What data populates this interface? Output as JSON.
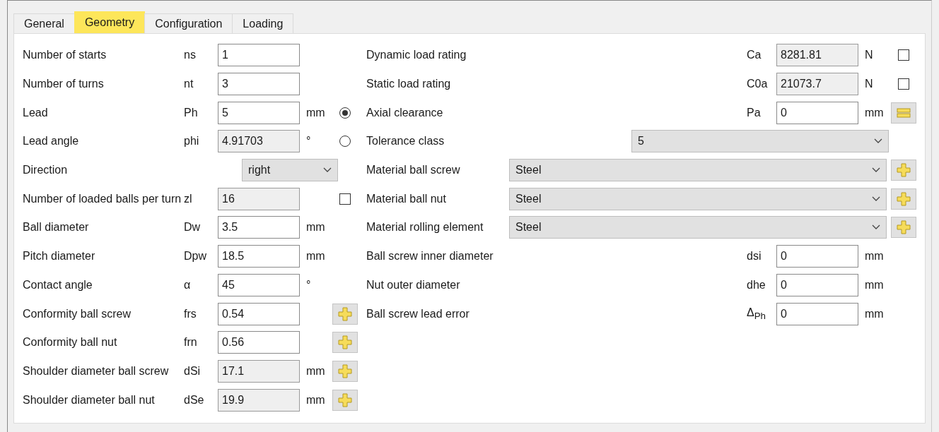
{
  "tabs": [
    {
      "label": "General",
      "selected": false
    },
    {
      "label": "Geometry",
      "selected": true
    },
    {
      "label": "Configuration",
      "selected": false
    },
    {
      "label": "Loading",
      "selected": false
    }
  ],
  "left_rows": [
    {
      "label": "Number of starts",
      "symbol": "ns",
      "value": "1",
      "readonly": false
    },
    {
      "label": "Number of turns",
      "symbol": "nt",
      "value": "3",
      "readonly": false
    },
    {
      "label": "Lead",
      "symbol": "Ph",
      "value": "5",
      "readonly": false,
      "unit": "mm",
      "extra": {
        "kind": "radio",
        "selected": true
      }
    },
    {
      "label": "Lead angle",
      "symbol": "phi",
      "value": "4.91703",
      "readonly": true,
      "unit": "°",
      "extra": {
        "kind": "radio",
        "selected": false
      }
    },
    {
      "label": "Direction",
      "kind": "select",
      "value": "right"
    },
    {
      "label": "Number of loaded balls per turn",
      "symbol": "zl",
      "value": "16",
      "readonly": true,
      "extra": {
        "kind": "checkbox",
        "checked": false
      }
    },
    {
      "label": "Ball diameter",
      "symbol": "Dw",
      "value": "3.5",
      "readonly": false,
      "unit": "mm"
    },
    {
      "label": "Pitch diameter",
      "symbol": "Dpw",
      "value": "18.5",
      "readonly": false,
      "unit": "mm"
    },
    {
      "label": "Contact angle",
      "symbol": "α",
      "value": "45",
      "readonly": false,
      "unit": "°"
    },
    {
      "label": "Conformity ball screw",
      "symbol": "frs",
      "value": "0.54",
      "readonly": false,
      "extra": {
        "kind": "plus"
      }
    },
    {
      "label": "Conformity ball nut",
      "symbol": "frn",
      "value": "0.56",
      "readonly": false,
      "extra": {
        "kind": "plus"
      }
    },
    {
      "label": "Shoulder diameter ball screw",
      "symbol": "dSi",
      "value": "17.1",
      "readonly": true,
      "unit": "mm",
      "extra": {
        "kind": "plus"
      }
    },
    {
      "label": "Shoulder diameter ball nut",
      "symbol": "dSe",
      "value": "19.9",
      "readonly": true,
      "unit": "mm",
      "extra": {
        "kind": "plus"
      }
    }
  ],
  "right_rows": [
    {
      "kind": "field",
      "label": "Dynamic load rating",
      "symbol": "Ca",
      "value": "8281.81",
      "readonly": true,
      "unit": "N",
      "extra": {
        "kind": "checkbox",
        "checked": false
      }
    },
    {
      "kind": "field",
      "label": "Static load rating",
      "symbol": "C0a",
      "value": "21073.7",
      "readonly": true,
      "unit": "N",
      "extra": {
        "kind": "checkbox",
        "checked": false
      }
    },
    {
      "kind": "field",
      "label": "Axial clearance",
      "symbol": "Pa",
      "value": "0",
      "readonly": false,
      "unit": "mm",
      "extra": {
        "kind": "equals"
      }
    },
    {
      "kind": "short-select",
      "label": "Tolerance class",
      "value": "5"
    },
    {
      "kind": "select",
      "label": "Material ball screw",
      "value": "Steel",
      "extra": {
        "kind": "plus"
      }
    },
    {
      "kind": "select",
      "label": "Material ball nut",
      "value": "Steel",
      "extra": {
        "kind": "plus"
      }
    },
    {
      "kind": "select",
      "label": "Material rolling element",
      "value": "Steel",
      "extra": {
        "kind": "plus"
      }
    },
    {
      "kind": "field",
      "label": "Ball screw inner diameter",
      "symbol": "dsi",
      "value": "0",
      "readonly": false,
      "unit": "mm"
    },
    {
      "kind": "field",
      "label": "Nut outer diameter",
      "symbol": "dhe",
      "value": "0",
      "readonly": false,
      "unit": "mm"
    },
    {
      "kind": "field",
      "label": "Ball screw lead error",
      "symbol": "Δ$_{Ph}$",
      "value": "0",
      "readonly": false,
      "unit": "mm"
    }
  ]
}
